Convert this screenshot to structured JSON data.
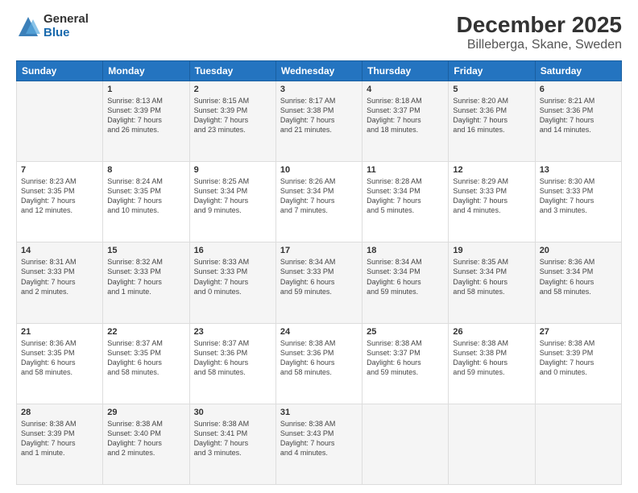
{
  "header": {
    "logo_general": "General",
    "logo_blue": "Blue",
    "title": "December 2025",
    "subtitle": "Billeberga, Skane, Sweden"
  },
  "days_of_week": [
    "Sunday",
    "Monday",
    "Tuesday",
    "Wednesday",
    "Thursday",
    "Friday",
    "Saturday"
  ],
  "weeks": [
    [
      {
        "num": "",
        "content": ""
      },
      {
        "num": "1",
        "content": "Sunrise: 8:13 AM\nSunset: 3:39 PM\nDaylight: 7 hours\nand 26 minutes."
      },
      {
        "num": "2",
        "content": "Sunrise: 8:15 AM\nSunset: 3:39 PM\nDaylight: 7 hours\nand 23 minutes."
      },
      {
        "num": "3",
        "content": "Sunrise: 8:17 AM\nSunset: 3:38 PM\nDaylight: 7 hours\nand 21 minutes."
      },
      {
        "num": "4",
        "content": "Sunrise: 8:18 AM\nSunset: 3:37 PM\nDaylight: 7 hours\nand 18 minutes."
      },
      {
        "num": "5",
        "content": "Sunrise: 8:20 AM\nSunset: 3:36 PM\nDaylight: 7 hours\nand 16 minutes."
      },
      {
        "num": "6",
        "content": "Sunrise: 8:21 AM\nSunset: 3:36 PM\nDaylight: 7 hours\nand 14 minutes."
      }
    ],
    [
      {
        "num": "7",
        "content": "Sunrise: 8:23 AM\nSunset: 3:35 PM\nDaylight: 7 hours\nand 12 minutes."
      },
      {
        "num": "8",
        "content": "Sunrise: 8:24 AM\nSunset: 3:35 PM\nDaylight: 7 hours\nand 10 minutes."
      },
      {
        "num": "9",
        "content": "Sunrise: 8:25 AM\nSunset: 3:34 PM\nDaylight: 7 hours\nand 9 minutes."
      },
      {
        "num": "10",
        "content": "Sunrise: 8:26 AM\nSunset: 3:34 PM\nDaylight: 7 hours\nand 7 minutes."
      },
      {
        "num": "11",
        "content": "Sunrise: 8:28 AM\nSunset: 3:34 PM\nDaylight: 7 hours\nand 5 minutes."
      },
      {
        "num": "12",
        "content": "Sunrise: 8:29 AM\nSunset: 3:33 PM\nDaylight: 7 hours\nand 4 minutes."
      },
      {
        "num": "13",
        "content": "Sunrise: 8:30 AM\nSunset: 3:33 PM\nDaylight: 7 hours\nand 3 minutes."
      }
    ],
    [
      {
        "num": "14",
        "content": "Sunrise: 8:31 AM\nSunset: 3:33 PM\nDaylight: 7 hours\nand 2 minutes."
      },
      {
        "num": "15",
        "content": "Sunrise: 8:32 AM\nSunset: 3:33 PM\nDaylight: 7 hours\nand 1 minute."
      },
      {
        "num": "16",
        "content": "Sunrise: 8:33 AM\nSunset: 3:33 PM\nDaylight: 7 hours\nand 0 minutes."
      },
      {
        "num": "17",
        "content": "Sunrise: 8:34 AM\nSunset: 3:33 PM\nDaylight: 6 hours\nand 59 minutes."
      },
      {
        "num": "18",
        "content": "Sunrise: 8:34 AM\nSunset: 3:34 PM\nDaylight: 6 hours\nand 59 minutes."
      },
      {
        "num": "19",
        "content": "Sunrise: 8:35 AM\nSunset: 3:34 PM\nDaylight: 6 hours\nand 58 minutes."
      },
      {
        "num": "20",
        "content": "Sunrise: 8:36 AM\nSunset: 3:34 PM\nDaylight: 6 hours\nand 58 minutes."
      }
    ],
    [
      {
        "num": "21",
        "content": "Sunrise: 8:36 AM\nSunset: 3:35 PM\nDaylight: 6 hours\nand 58 minutes."
      },
      {
        "num": "22",
        "content": "Sunrise: 8:37 AM\nSunset: 3:35 PM\nDaylight: 6 hours\nand 58 minutes."
      },
      {
        "num": "23",
        "content": "Sunrise: 8:37 AM\nSunset: 3:36 PM\nDaylight: 6 hours\nand 58 minutes."
      },
      {
        "num": "24",
        "content": "Sunrise: 8:38 AM\nSunset: 3:36 PM\nDaylight: 6 hours\nand 58 minutes."
      },
      {
        "num": "25",
        "content": "Sunrise: 8:38 AM\nSunset: 3:37 PM\nDaylight: 6 hours\nand 59 minutes."
      },
      {
        "num": "26",
        "content": "Sunrise: 8:38 AM\nSunset: 3:38 PM\nDaylight: 6 hours\nand 59 minutes."
      },
      {
        "num": "27",
        "content": "Sunrise: 8:38 AM\nSunset: 3:39 PM\nDaylight: 7 hours\nand 0 minutes."
      }
    ],
    [
      {
        "num": "28",
        "content": "Sunrise: 8:38 AM\nSunset: 3:39 PM\nDaylight: 7 hours\nand 1 minute."
      },
      {
        "num": "29",
        "content": "Sunrise: 8:38 AM\nSunset: 3:40 PM\nDaylight: 7 hours\nand 2 minutes."
      },
      {
        "num": "30",
        "content": "Sunrise: 8:38 AM\nSunset: 3:41 PM\nDaylight: 7 hours\nand 3 minutes."
      },
      {
        "num": "31",
        "content": "Sunrise: 8:38 AM\nSunset: 3:43 PM\nDaylight: 7 hours\nand 4 minutes."
      },
      {
        "num": "",
        "content": ""
      },
      {
        "num": "",
        "content": ""
      },
      {
        "num": "",
        "content": ""
      }
    ]
  ]
}
